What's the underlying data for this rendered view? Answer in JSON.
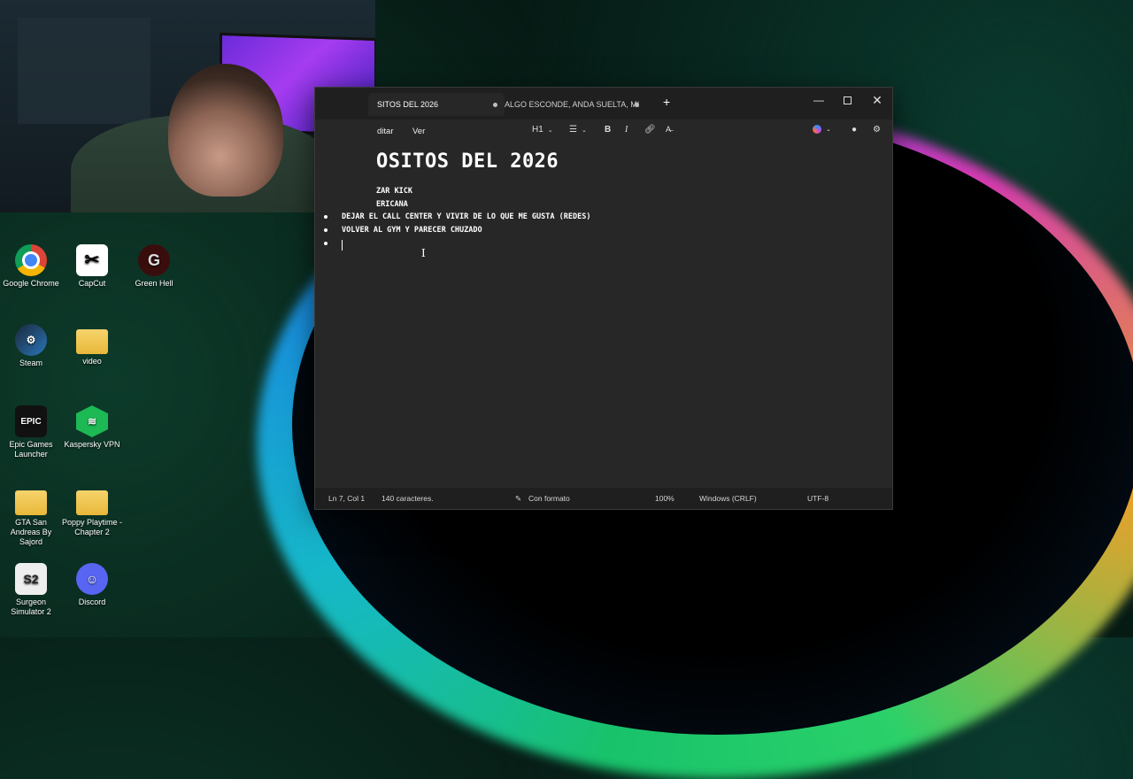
{
  "desktop": {
    "icons": [
      {
        "label": "Google Chrome"
      },
      {
        "label": "CapCut"
      },
      {
        "label": "Green Hell"
      },
      {
        "label": "Steam"
      },
      {
        "label": "video"
      },
      {
        "label": "Epic Games Launcher"
      },
      {
        "label": "Kaspersky VPN"
      },
      {
        "label": "GTA San Andreas By Sajord"
      },
      {
        "label": "Poppy Playtime - Chapter 2"
      },
      {
        "label": "Surgeon Simulator 2"
      },
      {
        "label": "Discord"
      }
    ]
  },
  "notepad": {
    "tabs": [
      {
        "label": "SITOS DEL 2026"
      },
      {
        "label": "ALGO ESCONDE, ANDA SUELTA, MI"
      }
    ],
    "menus": {
      "edit": "ditar",
      "view": "Ver"
    },
    "toolbar": {
      "heading": "H1"
    },
    "document": {
      "heading": "OSITOS DEL 2026",
      "lines": [
        "ZAR KICK",
        "ERICANA",
        "DEJAR EL CALL CENTER Y VIVIR DE LO QUE ME GUSTA (REDES)",
        "VOLVER AL GYM Y PARECER CHUZADO",
        ""
      ]
    },
    "status": {
      "position": "Ln 7, Col 1",
      "chars": "140 caracteres.",
      "format": "Con formato",
      "zoom": "100%",
      "eol": "Windows (CRLF)",
      "encoding": "UTF-8"
    }
  },
  "colors": {
    "window_bg": "#272727",
    "titlebar_bg": "#1f1f1f",
    "accent": "#18c26b"
  }
}
